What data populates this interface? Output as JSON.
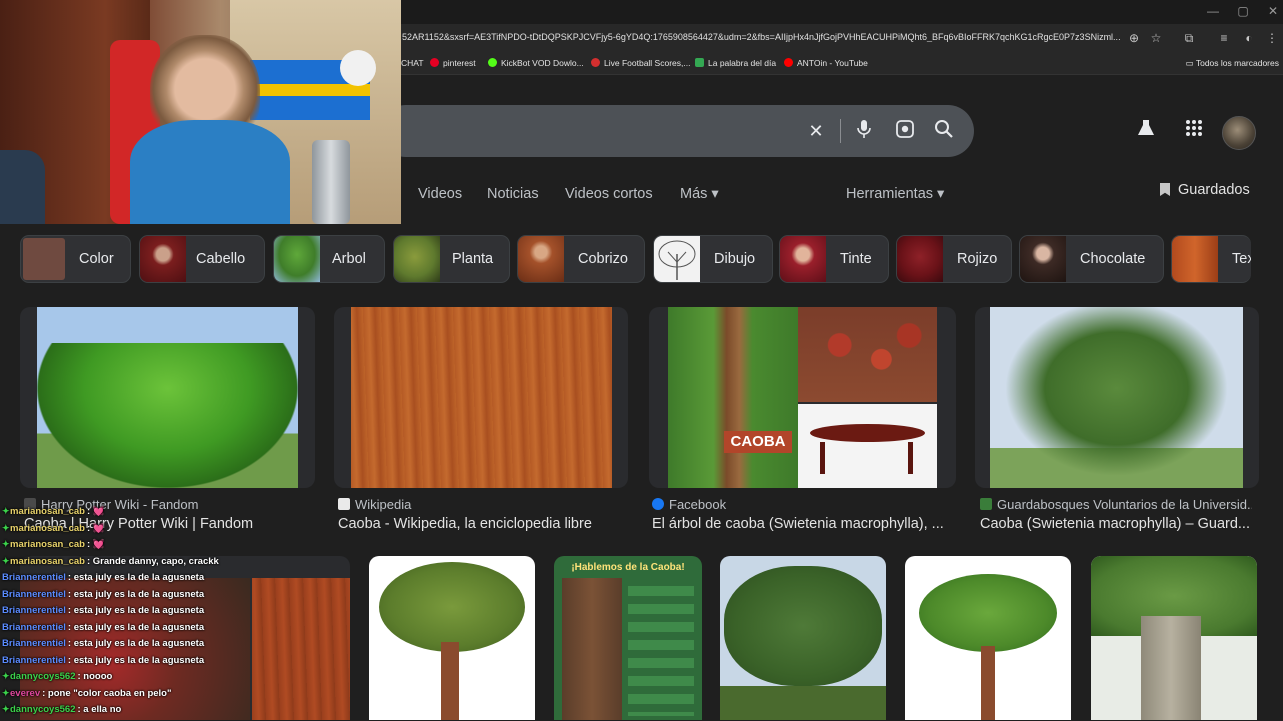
{
  "browser": {
    "url": "52AR1152&sxsrf=AE3TifNPDO-tDtDQPSKPJCVFjy5-6gYD4Q:1765908564427&udm=2&fbs=AIIjpHx4nJjfGojPVHhEACUHPiMQht6_BFq6vBIoFFRK7qchKG1cRgcE0P7z3SNizml...",
    "bookmarks": [
      {
        "label": "CHAT",
        "color": "#282828"
      },
      {
        "label": "pinterest",
        "color": "#e60023"
      },
      {
        "label": "KickBot VOD Dowlo...",
        "color": "#53fc18"
      },
      {
        "label": "Live Football Scores,...",
        "color": "#d32f2f"
      },
      {
        "label": "La palabra del día",
        "color": "#34a853"
      },
      {
        "label": "ANTOin - YouTube",
        "color": "#ff0000"
      }
    ],
    "bookmarks_all": "Todos los marcadores"
  },
  "search": {
    "clear_icon": "close-icon",
    "voice_icon": "mic-icon",
    "lens_icon": "camera-lens-icon",
    "search_icon": "search-icon"
  },
  "tabs": [
    {
      "label": "Videos"
    },
    {
      "label": "Noticias"
    },
    {
      "label": "Videos cortos"
    },
    {
      "label": "Más ▾"
    }
  ],
  "tools_label": "Herramientas ▾",
  "saved_label": "Guardados",
  "chips": [
    {
      "label": "Color",
      "color": "#6f4a40"
    },
    {
      "label": "Cabello",
      "color": "#7b1e1e"
    },
    {
      "label": "Arbol",
      "color": "#3f7d2a"
    },
    {
      "label": "Planta",
      "color": "#5f7a2e"
    },
    {
      "label": "Cobrizo",
      "color": "#a4512a"
    },
    {
      "label": "Dibujo",
      "color": "#f2f2f2"
    },
    {
      "label": "Tinte",
      "color": "#9a1f2b"
    },
    {
      "label": "Rojizo",
      "color": "#6a1218"
    },
    {
      "label": "Chocolate",
      "color": "#3d2a25"
    },
    {
      "label": "Tex",
      "color": "#b24a1e"
    }
  ],
  "results": [
    {
      "source": "Harry Potter Wiki - Fandom",
      "title": "Caoba | Harry Potter Wiki | Fandom",
      "fav_color": "#4a4a4a"
    },
    {
      "source": "Wikipedia",
      "title": "Caoba - Wikipedia, la enciclopedia libre",
      "fav_color": "#eaeaea"
    },
    {
      "source": "Facebook",
      "title": "El árbol de caoba (Swietenia macrophylla), ...",
      "fav_color": "#1877f2",
      "overlay": "CAOBA"
    },
    {
      "source": "Guardabosques Voluntarios de la Universid...",
      "title": "Caoba (Swietenia macrophylla) – Guard...",
      "fav_color": "#3a7d3a"
    }
  ],
  "infographic_title": "¡Hablemos de la Caoba!",
  "chat": [
    {
      "user": "marianosan_cab",
      "text": ": 💓",
      "color": "#e9d36b"
    },
    {
      "user": "marianosan_cab",
      "text": ": 💓",
      "color": "#e9d36b"
    },
    {
      "user": "marianosan_cab",
      "text": ": 💓",
      "color": "#e9d36b"
    },
    {
      "user": "marianosan_cab",
      "text": ": Grande danny, capo, crackk",
      "color": "#e9d36b"
    },
    {
      "user": "Briannerentiel",
      "text": ": esta july es la de la agusneta",
      "color": "#5b8cff"
    },
    {
      "user": "Briannerentiel",
      "text": ": esta july es la de la agusneta",
      "color": "#5b8cff"
    },
    {
      "user": "Briannerentiel",
      "text": ": esta july es la de la agusneta",
      "color": "#5b8cff"
    },
    {
      "user": "Briannerentiel",
      "text": ": esta july es la de la agusneta",
      "color": "#5b8cff"
    },
    {
      "user": "Briannerentiel",
      "text": ": esta july es la de la agusneta",
      "color": "#5b8cff"
    },
    {
      "user": "Briannerentiel",
      "text": ": esta july es la de la agusneta",
      "color": "#5b8cff"
    },
    {
      "user": "dannycoys562",
      "text": ": noooo",
      "color": "#3bd24b"
    },
    {
      "user": "everev",
      "text": ": pone \"color caoba en pelo\"",
      "color": "#e0479e"
    },
    {
      "user": "dannycoys562",
      "text": ": a ella no",
      "color": "#3bd24b"
    }
  ]
}
